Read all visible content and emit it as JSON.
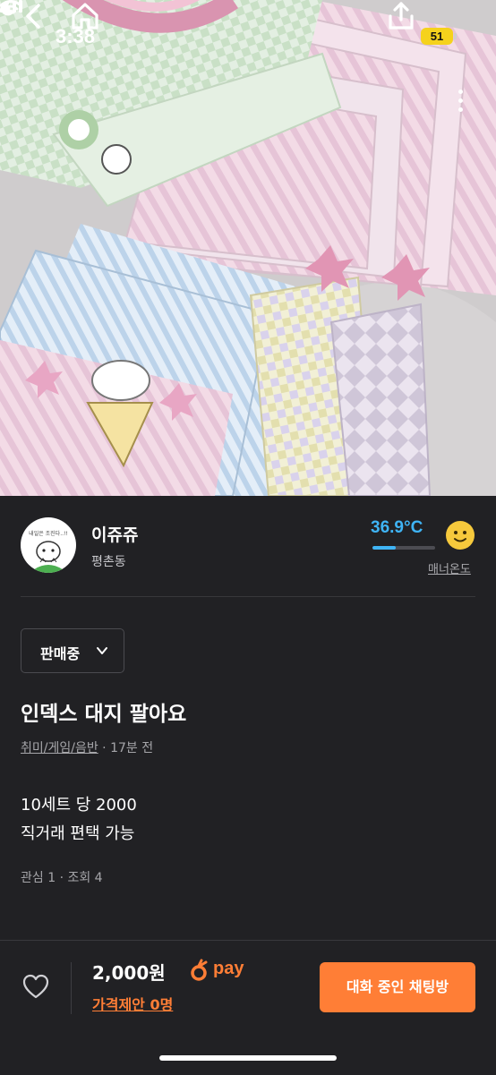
{
  "status_bar": {
    "time": "3:38",
    "battery": "51"
  },
  "nav": {
    "back_icon": "chevron-left-icon",
    "home_icon": "home-icon",
    "share_icon": "share-icon",
    "more_icon": "more-vertical-icon"
  },
  "seller": {
    "name": "이쥬쥬",
    "location": "평촌동",
    "avatar_caption": "내일은 조진다..!!",
    "temperature": "36.9°C",
    "temperature_level": 0.369,
    "manner_label": "매너온도"
  },
  "listing": {
    "status": "판매중",
    "title": "인덱스 대지 팔아요",
    "category": "취미/게임/음반",
    "posted": "· 17분 전",
    "description_line1": "10세트 당 2000",
    "description_line2": "직거래 편택 가능",
    "stats": "관심 1 · 조회 4"
  },
  "bottom_bar": {
    "price": "2,000원",
    "pay_label": "pay",
    "price_offer": "가격제안 0명",
    "chat_button": "대화 중인 채팅방"
  },
  "colors": {
    "accent": "#ff7e36",
    "temperature": "#3fb4f5",
    "background": "#212124"
  }
}
